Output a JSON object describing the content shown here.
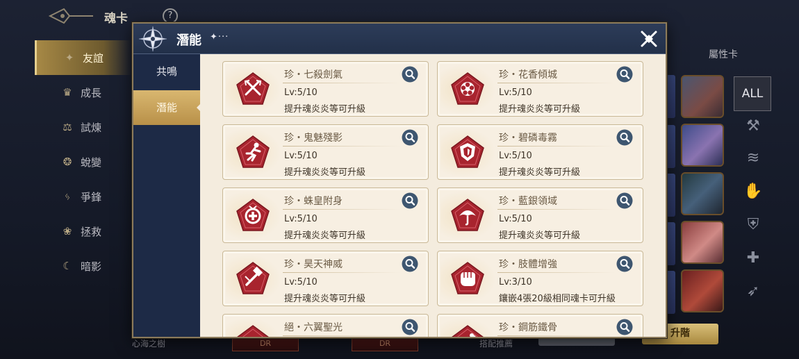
{
  "background": {
    "header_title": "魂卡",
    "help_label": "?",
    "sidebar": [
      {
        "label": "友誼",
        "icon": "star-compass-icon",
        "active": true
      },
      {
        "label": "成長",
        "icon": "crown-icon",
        "active": false
      },
      {
        "label": "試煉",
        "icon": "scales-icon",
        "active": false
      },
      {
        "label": "蛻變",
        "icon": "swirl-icon",
        "active": false
      },
      {
        "label": "爭鋒",
        "icon": "claw-icon",
        "active": false
      },
      {
        "label": "拯救",
        "icon": "lotus-icon",
        "active": false
      },
      {
        "label": "暗影",
        "icon": "shadow-icon",
        "active": false
      }
    ],
    "footer_left": "心海之樹",
    "footer_mid": "搭配推薦",
    "dr_label": "DR",
    "advance_button": "升階",
    "attribute_label": "屬性卡",
    "all_filter": "ALL"
  },
  "modal": {
    "title": "潛能",
    "title_deco": "✦···",
    "tabs": [
      {
        "label": "共鳴",
        "active": false
      },
      {
        "label": "潛能",
        "active": true
      }
    ],
    "cards": [
      {
        "name": "珍・七殺劍氣",
        "level": "Lv:5/10",
        "desc": "提升魂炎炎等可升級",
        "icon": "crossed-swords-icon"
      },
      {
        "name": "珍・花香傾城",
        "level": "Lv:5/10",
        "desc": "提升魂炎炎等可升級",
        "icon": "flower-icon"
      },
      {
        "name": "珍・鬼魅殘影",
        "level": "Lv:5/10",
        "desc": "提升魂炎炎等可升級",
        "icon": "running-figure-icon"
      },
      {
        "name": "珍・碧磷毒霧",
        "level": "Lv:5/10",
        "desc": "提升魂炎炎等可升級",
        "icon": "shield-icon"
      },
      {
        "name": "珍・蛛皇附身",
        "level": "Lv:5/10",
        "desc": "提升魂炎炎等可升級",
        "icon": "plus-circle-icon"
      },
      {
        "name": "珍・藍銀領域",
        "level": "Lv:5/10",
        "desc": "提升魂炎炎等可升級",
        "icon": "umbrella-icon"
      },
      {
        "name": "珍・昊天神威",
        "level": "Lv:5/10",
        "desc": "提升魂炎炎等可升級",
        "icon": "hammer-icon"
      },
      {
        "name": "珍・肢體增強",
        "level": "Lv:3/10",
        "desc": "鑲嵌4張20級相同魂卡可升級",
        "icon": "fist-icon"
      },
      {
        "name": "絕・六翼聖光",
        "level": "",
        "desc": "",
        "icon": "wings-icon"
      },
      {
        "name": "珍・鋼筋鐵骨",
        "level": "",
        "desc": "",
        "icon": "bone-icon"
      }
    ]
  },
  "colors": {
    "badge_red": "#a8242e",
    "panel_cream": "#f4ecde",
    "header_navy": "#2d3c59",
    "tab_gold": "#d9b770"
  }
}
